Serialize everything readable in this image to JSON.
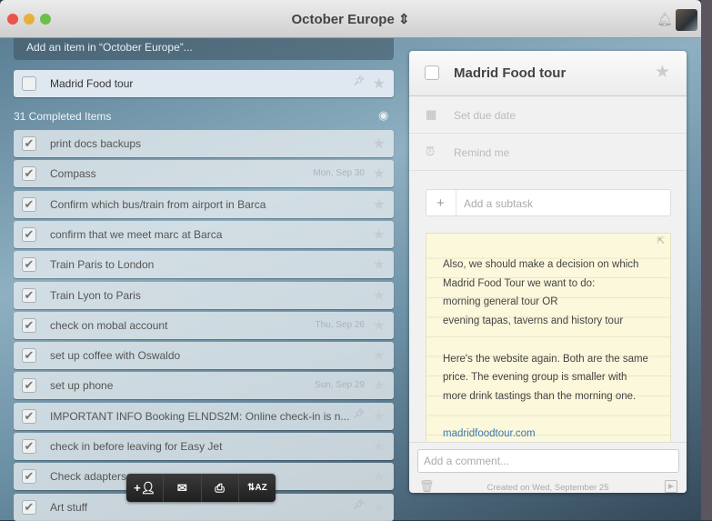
{
  "window": {
    "title": "October Europe ⁝",
    "title_text": "October Europe",
    "colors": {
      "accent": "#3d78a8",
      "note": "#fbf8dc"
    }
  },
  "list": {
    "add_placeholder": "Add an item in “October Europe”...",
    "active_item": {
      "label": "Madrid Food tour",
      "pinned": true,
      "starred": false
    },
    "completed_label": "31 Completed Items",
    "completed": [
      {
        "label": "print docs backups",
        "date": "",
        "pinned": false
      },
      {
        "label": "Compass",
        "date": "Mon, Sep 30",
        "pinned": false
      },
      {
        "label": "Confirm which bus/train from airport in Barca",
        "date": "",
        "pinned": false
      },
      {
        "label": "confirm that we meet marc at Barca",
        "date": "",
        "pinned": false
      },
      {
        "label": "Train Paris to London",
        "date": "",
        "pinned": false
      },
      {
        "label": "Train Lyon to Paris",
        "date": "",
        "pinned": false
      },
      {
        "label": "check on mobal account",
        "date": "Thu, Sep 26",
        "pinned": false
      },
      {
        "label": "set up coffee with Oswaldo",
        "date": "",
        "pinned": false
      },
      {
        "label": "set up phone",
        "date": "Sun, Sep 29",
        "pinned": false
      },
      {
        "label": "IMPORTANT INFO Booking ELNDS2M: Online check-in is n...",
        "date": "",
        "pinned": true
      },
      {
        "label": "check in before leaving for Easy Jet",
        "date": "",
        "pinned": false
      },
      {
        "label": "Check adapters",
        "date": "",
        "pinned": false
      },
      {
        "label": "Art stuff",
        "date": "",
        "pinned": true
      }
    ]
  },
  "detail": {
    "title": "Madrid Food tour",
    "due_date": "Set due date",
    "remind": "Remind me",
    "subtask_placeholder": "Add a subtask",
    "note_lines": [
      "Also, we should make a decision on which",
      "Madrid Food Tour we want to do:",
      "morning general tour OR",
      "evening tapas, taverns and history tour",
      "",
      "Here's the website again. Both are the same",
      "price. The evening group is smaller with",
      "more drink tastings than the morning one.",
      ""
    ],
    "note_link": "madridfoodtour.com",
    "comment_placeholder": "Add a comment...",
    "created": "Created on Wed, September 25"
  },
  "toolbar": {
    "icons": [
      "add-person-icon",
      "mail-icon",
      "print-icon",
      "sort-az-icon"
    ]
  }
}
